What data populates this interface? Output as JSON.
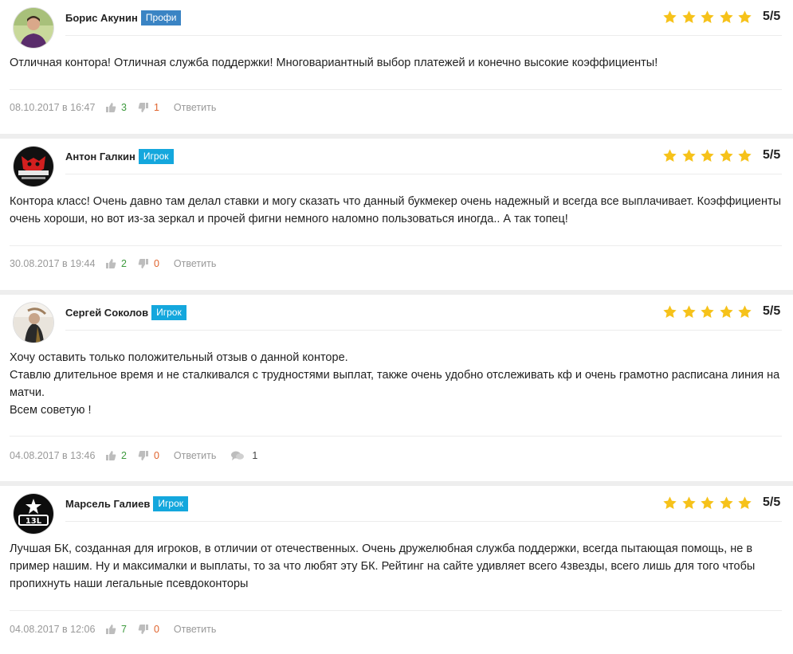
{
  "colors": {
    "badge_profi": "#3a84c4",
    "badge_igrok": "#14a7dd",
    "star": "#f6c21a",
    "like": "#3d9a3d",
    "dislike": "#e0632d"
  },
  "reviews": [
    {
      "author": "Борис Акунин",
      "badge": "Профи",
      "rating": "5/5",
      "stars": 5,
      "text": [
        "Отличная контора! Отличная служба поддержки! Многовариантный выбор платежей и конечно высокие коэффициенты!"
      ],
      "date": "08.10.2017 в 16:47",
      "likes": "3",
      "dislikes": "1",
      "reply": "Ответить"
    },
    {
      "author": "Антон Галкин",
      "badge": "Игрок",
      "rating": "5/5",
      "stars": 5,
      "text": [
        "Контора класс! Очень давно там делал ставки и могу сказать что данный букмекер очень надежный и всегда все выплачивает. Коэффициенты очень хороши, но вот из-за зеркал и прочей фигни немного наломно пользоваться иногда.. А так топец!"
      ],
      "date": "30.08.2017 в 19:44",
      "likes": "2",
      "dislikes": "0",
      "reply": "Ответить"
    },
    {
      "author": "Сергей Соколов",
      "badge": "Игрок",
      "rating": "5/5",
      "stars": 5,
      "text": [
        "Хочу оставить только положительный отзыв о данной конторе.",
        "Ставлю длительное время и не сталкивался с трудностями выплат, также очень удобно отслеживать кф и очень грамотно расписана линия на матчи.",
        "Всем советую !"
      ],
      "date": "04.08.2017 в 13:46",
      "likes": "2",
      "dislikes": "0",
      "reply": "Ответить",
      "comments": "1"
    },
    {
      "author": "Марсель Галиев",
      "badge": "Игрок",
      "rating": "5/5",
      "stars": 5,
      "text": [
        "Лучшая БК, созданная для игроков, в отличии от отечественных. Очень дружелюбная служба поддержки, всегда пытающая помощь, не в пример нашим. Ну и максималки и выплаты, то за что любят эту БК. Рейтинг на сайте удивляет всего 4звезды, всего лишь для того чтобы пропихнуть наши легальные псевдоконторы"
      ],
      "date": "04.08.2017 в 12:06",
      "likes": "7",
      "dislikes": "0",
      "reply": "Ответить"
    }
  ]
}
